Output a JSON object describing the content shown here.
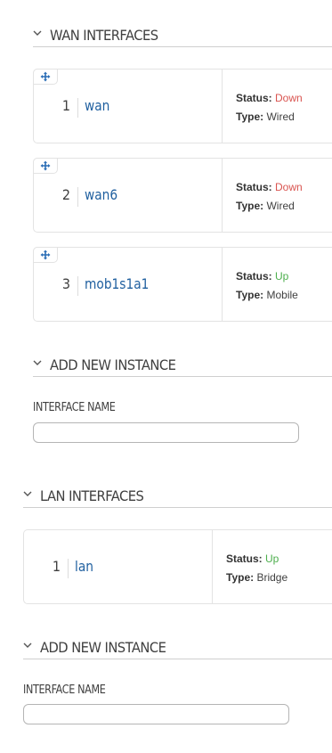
{
  "wan_section": {
    "title": "WAN INTERFACES",
    "items": [
      {
        "index": "1",
        "name": "wan",
        "status_label": "Status:",
        "status": "Down",
        "type_label": "Type:",
        "type": "Wired"
      },
      {
        "index": "2",
        "name": "wan6",
        "status_label": "Status:",
        "status": "Down",
        "type_label": "Type:",
        "type": "Wired"
      },
      {
        "index": "3",
        "name": "mob1s1a1",
        "status_label": "Status:",
        "status": "Up",
        "type_label": "Type:",
        "type": "Mobile"
      }
    ],
    "add_new": {
      "title": "ADD NEW INSTANCE",
      "field_label": "INTERFACE NAME",
      "value": "",
      "placeholder": ""
    }
  },
  "lan_section": {
    "title": "LAN INTERFACES",
    "items": [
      {
        "index": "1",
        "name": "lan",
        "status_label": "Status:",
        "status": "Up",
        "type_label": "Type:",
        "type": "Bridge"
      }
    ],
    "add_new": {
      "title": "ADD NEW INSTANCE",
      "field_label": "INTERFACE NAME",
      "value": "",
      "placeholder": ""
    }
  },
  "colors": {
    "link": "#1f5f9f",
    "status_down": "#d9534f",
    "status_up": "#4cae4c",
    "drag_icon": "#2a6db5"
  },
  "icons": {
    "collapse": "chevron-down-icon",
    "drag": "move-arrows-icon"
  }
}
